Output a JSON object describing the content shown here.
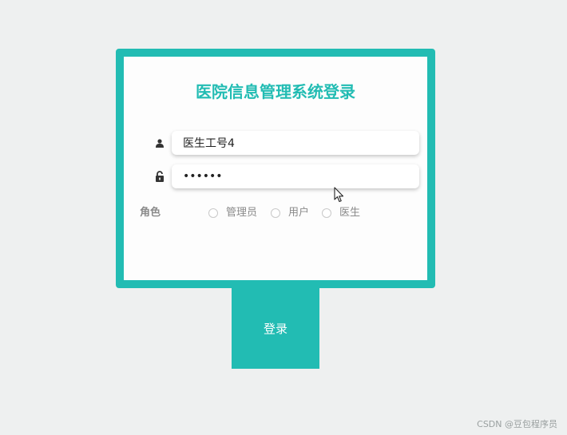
{
  "login": {
    "title": "医院信息管理系统登录",
    "username": {
      "icon": "user-icon",
      "value": "医生工号4"
    },
    "password": {
      "icon": "lock-icon",
      "value": "••••••"
    },
    "role": {
      "label": "角色",
      "options": [
        "管理员",
        "用户",
        "医生"
      ]
    },
    "submit_label": "登录"
  },
  "colors": {
    "accent": "#22bcb3",
    "background": "#eef0f0"
  },
  "watermark": "CSDN @豆包程序员"
}
